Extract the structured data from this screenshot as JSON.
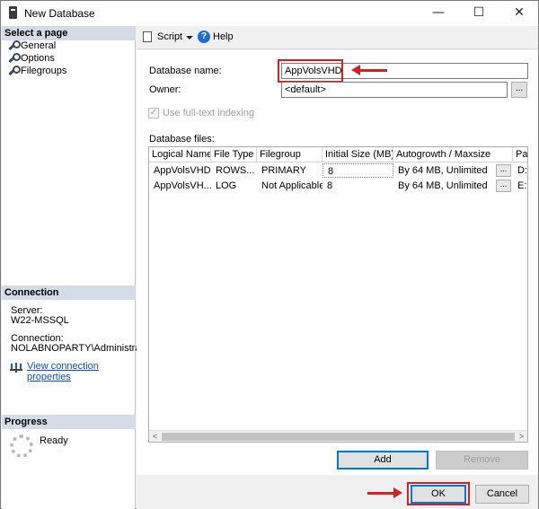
{
  "window": {
    "title": "New Database",
    "minimize_glyph": "—",
    "maximize_glyph": "☐",
    "close_glyph": "✕"
  },
  "left_panel": {
    "select_page_header": "Select a page",
    "pages": [
      {
        "label": "General",
        "icon": "wrench-icon"
      },
      {
        "label": "Options",
        "icon": "wrench-icon"
      },
      {
        "label": "Filegroups",
        "icon": "wrench-icon"
      }
    ],
    "connection_header": "Connection",
    "server_label": "Server:",
    "server_value": "W22-MSSQL",
    "connection_label": "Connection:",
    "connection_value": "NOLABNOPARTY\\Administrator",
    "view_connection_link": "View connection properties",
    "progress_header": "Progress",
    "progress_status": "Ready"
  },
  "toolbar": {
    "script_label": "Script",
    "help_label": "Help",
    "help_glyph": "?"
  },
  "form": {
    "database_name_label": "Database name:",
    "database_name_value": "AppVolsVHD",
    "owner_label": "Owner:",
    "owner_value": "<default>",
    "browse_glyph": "...",
    "fulltext_label": "Use full-text indexing",
    "fulltext_checked": true,
    "check_glyph": "✓",
    "database_files_label": "Database files:"
  },
  "grid": {
    "columns": [
      "Logical Name",
      "File Type",
      "Filegroup",
      "Initial Size (MB)",
      "Autogrowth / Maxsize",
      "Pa"
    ],
    "rows": [
      {
        "logical_name": "AppVolsVHD",
        "file_type": "ROWS...",
        "filegroup": "PRIMARY",
        "initial_size": "8",
        "autogrowth": "By 64 MB, Unlimited",
        "path": "D:"
      },
      {
        "logical_name": "AppVolsVH...",
        "file_type": "LOG",
        "filegroup": "Not Applicable",
        "initial_size": "8",
        "autogrowth": "By 64 MB, Unlimited",
        "path": "E:"
      }
    ],
    "ellipsis_glyph": "...",
    "scroll_left_glyph": "<",
    "scroll_right_glyph": ">"
  },
  "buttons": {
    "add": "Add",
    "remove": "Remove",
    "ok": "OK",
    "cancel": "Cancel"
  },
  "colors": {
    "annotation_red": "#d42020",
    "link_blue": "#0b4fb3",
    "section_header_bg": "#d4dce8",
    "focus_blue": "#0078d7"
  }
}
